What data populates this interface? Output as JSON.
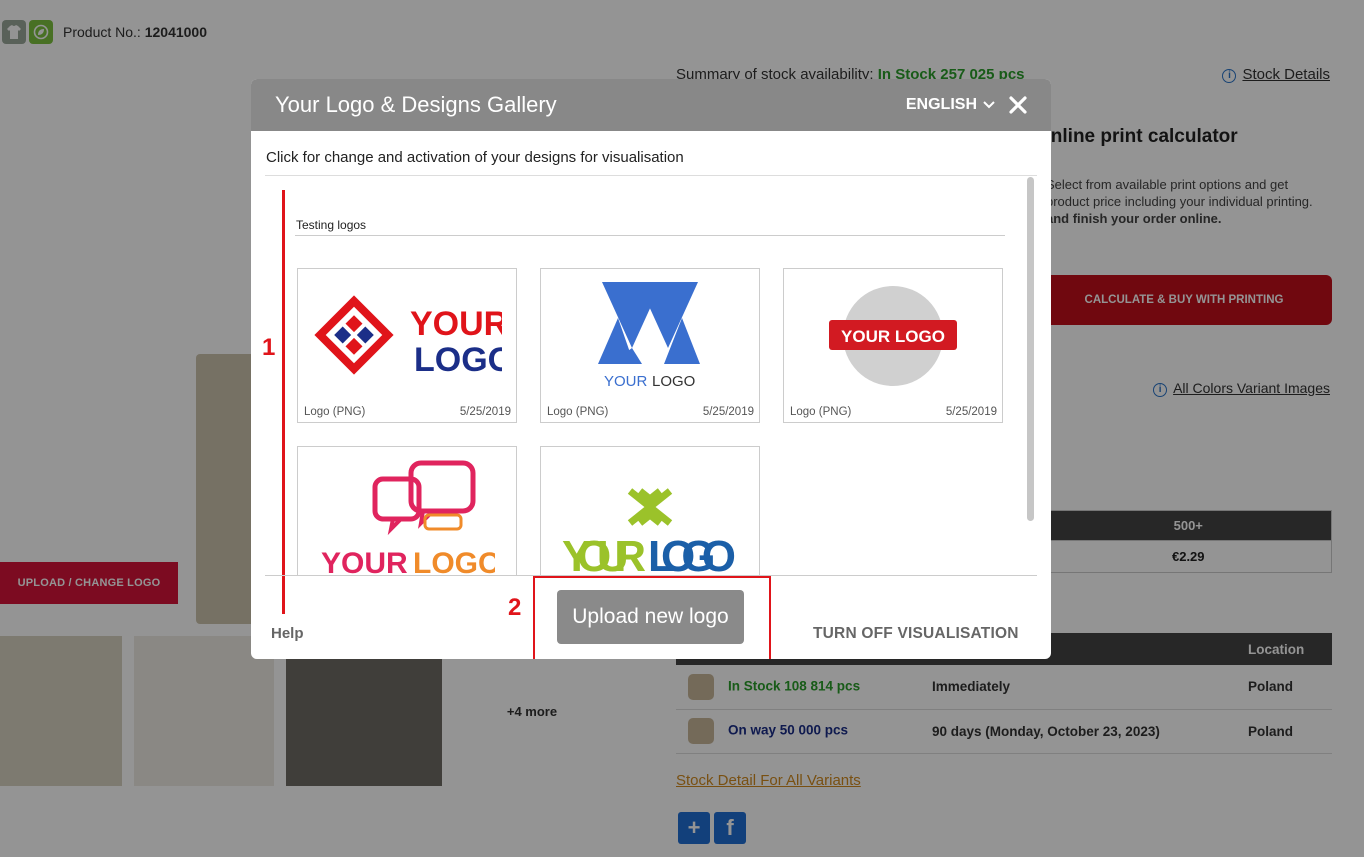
{
  "page": {
    "product_label": "Product No.:",
    "product_number": "12041000",
    "upload_change_label": "UPLOAD / CHANGE LOGO",
    "more_label": "+4 more",
    "stock_summary_label": "Summary of stock availability:",
    "stock_summary_value": "In Stock 257 025 pcs",
    "stock_details_label": "Stock Details",
    "calc_title": "Online print calculator",
    "calc_desc_1": "Select from available print options and get product price including your individual printing.",
    "calc_desc_2": "and finish your order online.",
    "calc_button": "CALCULATE & BUY WITH PRINTING",
    "all_colors_label": "All Colors Variant Images",
    "price_header": "500+",
    "price_value": "€2.29",
    "stock_table": {
      "location_header": "Location",
      "rows": [
        {
          "status": "In Stock 108 814 pcs",
          "time": "Immediately",
          "location": "Poland"
        },
        {
          "status": "On way 50 000 pcs",
          "time": "90 days (Monday, October 23, 2023)",
          "location": "Poland"
        }
      ]
    },
    "stock_all_label": "Stock Detail For All Variants"
  },
  "modal": {
    "title": "Your Logo & Designs Gallery",
    "language": "ENGLISH",
    "subtitle": "Click for change and activation of your designs for visualisation",
    "group_title": "Testing logos",
    "cards": [
      {
        "type": "Logo (PNG)",
        "date": "5/25/2019",
        "icon": "red-diamond-logo"
      },
      {
        "type": "Logo (PNG)",
        "date": "5/25/2019",
        "icon": "blue-triangle-logo"
      },
      {
        "type": "Logo (PNG)",
        "date": "5/25/2019",
        "icon": "grey-circle-logo"
      },
      {
        "type": "",
        "date": "",
        "icon": "chat-bubbles-logo"
      },
      {
        "type": "",
        "date": "",
        "icon": "green-cross-logo"
      }
    ],
    "help_label": "Help",
    "upload_label": "Upload new logo",
    "turnoff_label": "TURN OFF VISUALISATION",
    "annotation_1": "1",
    "annotation_2": "2"
  },
  "colors": {
    "accent_red": "#e0141a",
    "header_grey": "#888888",
    "in_stock_green": "#2a9d2a"
  }
}
